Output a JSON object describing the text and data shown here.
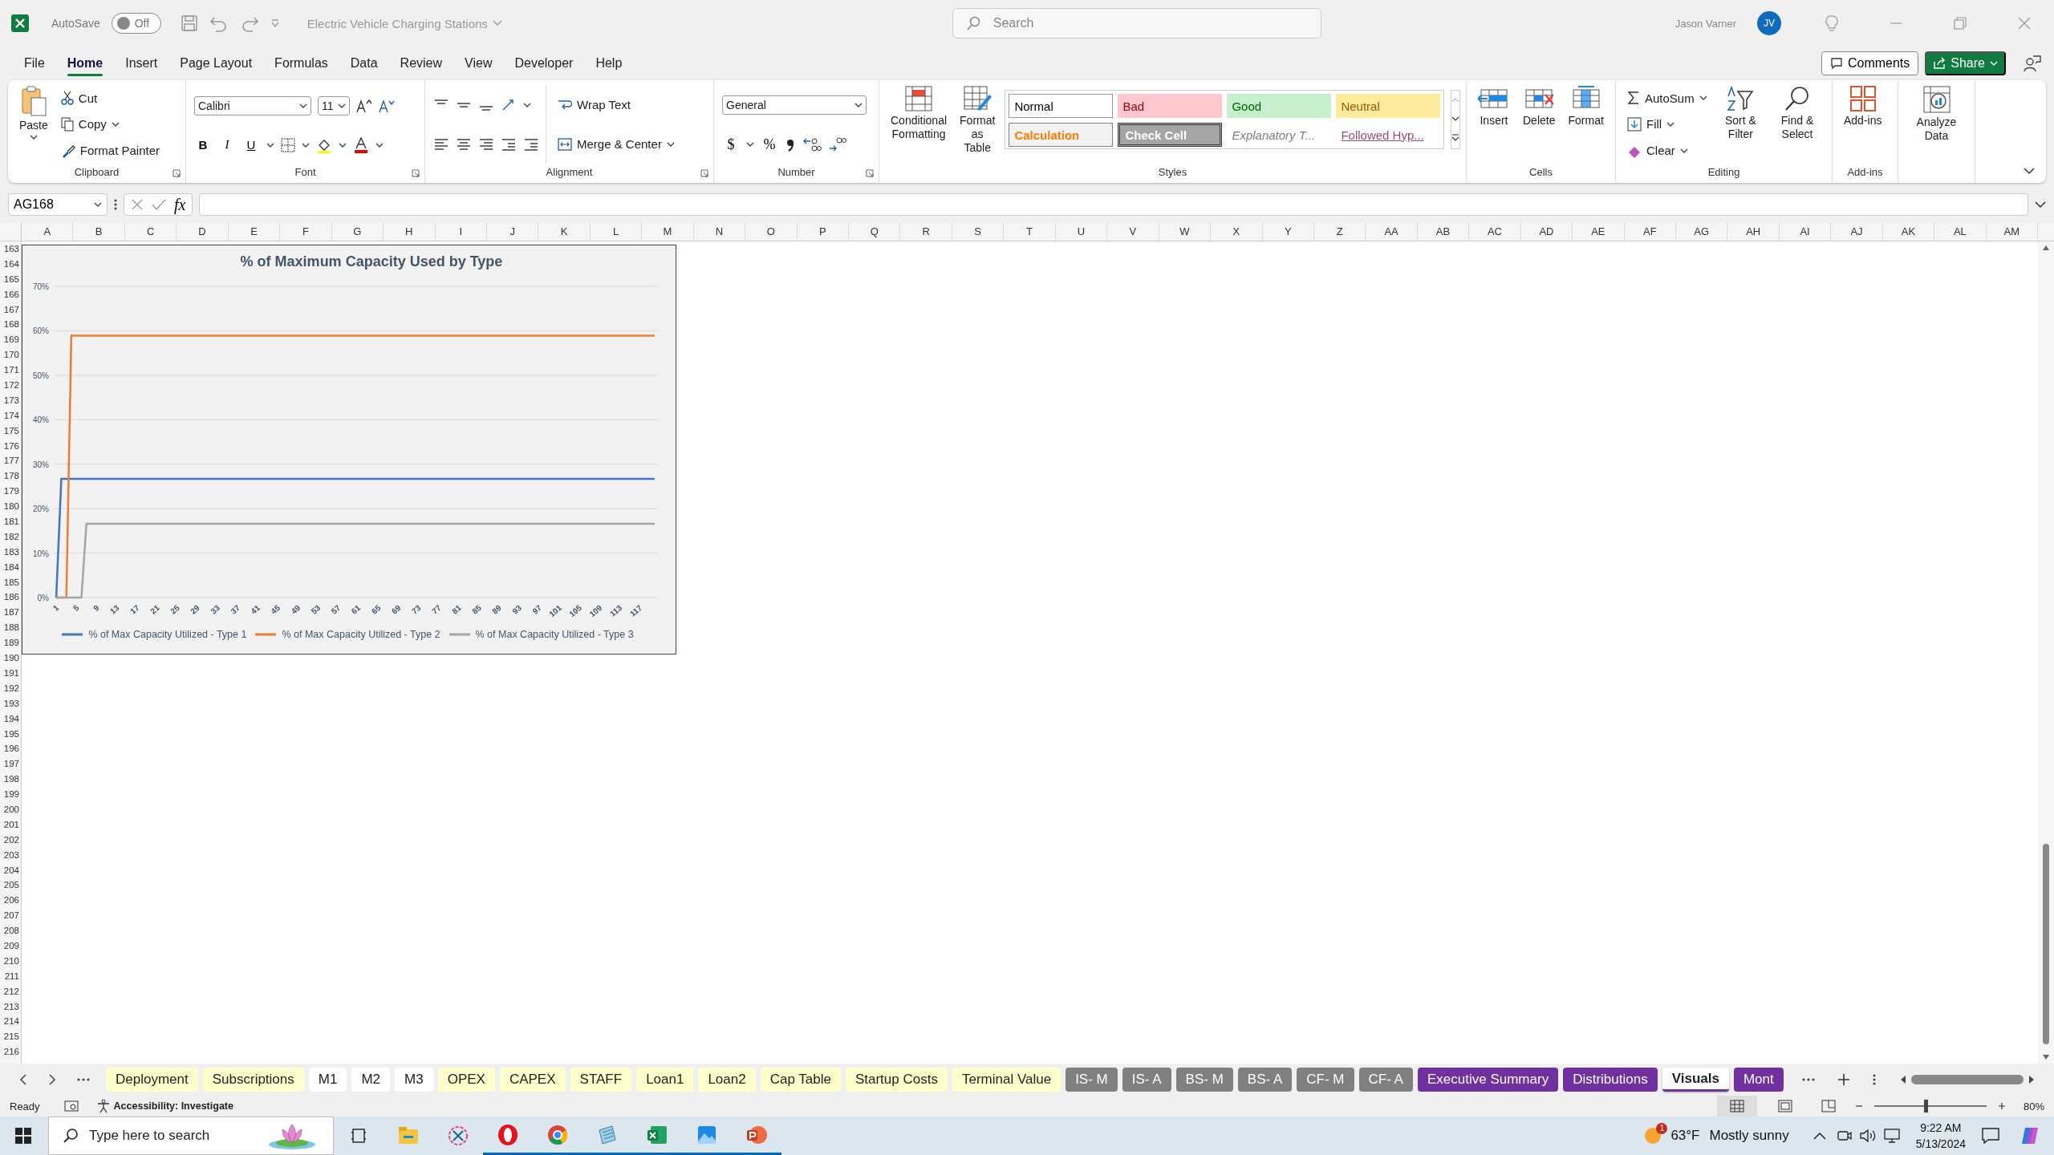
{
  "title_bar": {
    "autosave_label": "AutoSave",
    "autosave": {
      "on": false,
      "state_text": "Off"
    },
    "document_title": "Electric Vehicle Charging Stations",
    "search": {
      "placeholder": "Search"
    },
    "user_name": "Jason Varner",
    "avatar_initials": "JV"
  },
  "menu_tabs": [
    {
      "label": "File",
      "selected": false
    },
    {
      "label": "Home",
      "selected": true
    },
    {
      "label": "Insert",
      "selected": false
    },
    {
      "label": "Page Layout",
      "selected": false
    },
    {
      "label": "Formulas",
      "selected": false
    },
    {
      "label": "Data",
      "selected": false
    },
    {
      "label": "Review",
      "selected": false
    },
    {
      "label": "View",
      "selected": false
    },
    {
      "label": "Developer",
      "selected": false
    },
    {
      "label": "Help",
      "selected": false
    }
  ],
  "menu_actions": {
    "comments": "Comments",
    "share": "Share"
  },
  "ribbon": {
    "clipboard": {
      "label": "Clipboard",
      "paste": "Paste",
      "cut": "Cut",
      "copy": "Copy",
      "format_painter": "Format Painter"
    },
    "font": {
      "label": "Font",
      "name": "Calibri",
      "size": "11",
      "bold": "B",
      "italic": "I",
      "underline": "U"
    },
    "alignment": {
      "label": "Alignment",
      "wrap_text": "Wrap Text",
      "merge_center": "Merge & Center"
    },
    "number": {
      "label": "Number",
      "format": "General",
      "currency": "$",
      "percent": "%"
    },
    "styles": {
      "label": "Styles",
      "conditional_formatting": "Conditional Formatting",
      "format_as_table": "Format as Table",
      "gallery": [
        {
          "label": "Normal",
          "kind": "normal"
        },
        {
          "label": "Bad",
          "kind": "bad"
        },
        {
          "label": "Good",
          "kind": "good"
        },
        {
          "label": "Neutral",
          "kind": "neutral"
        },
        {
          "label": "Calculation",
          "kind": "calculation"
        },
        {
          "label": "Check Cell",
          "kind": "check"
        },
        {
          "label": "Explanatory T...",
          "kind": "explanatory"
        },
        {
          "label": "Followed Hyp...",
          "kind": "followed"
        }
      ]
    },
    "cells": {
      "label": "Cells",
      "insert": "Insert",
      "delete": "Delete",
      "format": "Format"
    },
    "editing": {
      "label": "Editing",
      "autosum": "AutoSum",
      "fill": "Fill",
      "clear": "Clear",
      "sort_filter": "Sort & Filter",
      "find_select": "Find & Select"
    },
    "addins": {
      "label": "Add-ins",
      "button": "Add-ins"
    },
    "analyze": {
      "button": "Analyze Data"
    }
  },
  "formula_bar": {
    "name_box": "AG168",
    "fx": "fx"
  },
  "sheet": {
    "columns": [
      "A",
      "B",
      "C",
      "D",
      "E",
      "F",
      "G",
      "H",
      "I",
      "J",
      "K",
      "L",
      "M",
      "N",
      "O",
      "P",
      "Q",
      "R",
      "S",
      "T",
      "U",
      "V",
      "W",
      "X",
      "Y",
      "Z",
      "AA",
      "AB",
      "AC",
      "AD",
      "AE",
      "AF",
      "AG",
      "AH",
      "AI",
      "AJ",
      "AK",
      "AL",
      "AM"
    ],
    "rows": [
      "163",
      "164",
      "165",
      "166",
      "167",
      "168",
      "169",
      "170",
      "171",
      "172",
      "173",
      "174",
      "175",
      "176",
      "177",
      "178",
      "179",
      "180",
      "181",
      "182",
      "183",
      "184",
      "185",
      "186",
      "187",
      "188",
      "189",
      "190",
      "191",
      "192",
      "193",
      "194",
      "195",
      "196",
      "197",
      "198",
      "199",
      "200",
      "201",
      "202",
      "203",
      "204",
      "205",
      "206",
      "207",
      "208",
      "209",
      "210",
      "211",
      "212",
      "213",
      "214",
      "215",
      "216"
    ],
    "chart_data": {
      "type": "line",
      "title": "% of Maximum Capacity Used by Type",
      "x": [
        1,
        2,
        3,
        4,
        5,
        6,
        7,
        8,
        9,
        10,
        11,
        12,
        13,
        14,
        15,
        16,
        17,
        18,
        19,
        20,
        21,
        22,
        23,
        24,
        25,
        26,
        27,
        28,
        29,
        30,
        31,
        32,
        33,
        34,
        35,
        36,
        37,
        38,
        39,
        40,
        41,
        42,
        43,
        44,
        45,
        46,
        47,
        48,
        49,
        50,
        51,
        52,
        53,
        54,
        55,
        56,
        57,
        58,
        59,
        60,
        61,
        62,
        63,
        64,
        65,
        66,
        67,
        68,
        69,
        70,
        71,
        72,
        73,
        74,
        75,
        76,
        77,
        78,
        79,
        80,
        81,
        82,
        83,
        84,
        85,
        86,
        87,
        88,
        89,
        90,
        91,
        92,
        93,
        94,
        95,
        96,
        97,
        98,
        99,
        100,
        101,
        102,
        103,
        104,
        105,
        106,
        107,
        108,
        109,
        110,
        111,
        112,
        113,
        114,
        115,
        116,
        117,
        118,
        119,
        120
      ],
      "xticks": [
        1,
        5,
        9,
        13,
        17,
        21,
        25,
        29,
        33,
        37,
        41,
        45,
        49,
        53,
        57,
        61,
        65,
        69,
        73,
        77,
        81,
        85,
        89,
        93,
        97,
        101,
        105,
        109,
        113,
        117
      ],
      "xlim": [
        0.5,
        120.5
      ],
      "ylim": [
        0,
        0.7
      ],
      "grid": true,
      "yticks": [
        {
          "value": 0,
          "label": "0%"
        },
        {
          "value": 0.1,
          "label": "10%"
        },
        {
          "value": 0.2,
          "label": "20%"
        },
        {
          "value": 0.3,
          "label": "30%"
        },
        {
          "value": 0.4,
          "label": "40%"
        },
        {
          "value": 0.5,
          "label": "50%"
        },
        {
          "value": 0.6,
          "label": "60%"
        },
        {
          "value": 0.7,
          "label": "70%"
        }
      ],
      "series": [
        {
          "name": "% of Max Capacity Utilized - Type 1",
          "color": "#4472c4",
          "values": [
            0,
            0.267,
            0.267,
            0.267,
            0.267,
            0.267,
            0.267,
            0.267,
            0.267,
            0.267,
            0.267,
            0.267,
            0.267,
            0.267,
            0.267,
            0.267,
            0.267,
            0.267,
            0.267,
            0.267,
            0.267,
            0.267,
            0.267,
            0.267,
            0.267,
            0.267,
            0.267,
            0.267,
            0.267,
            0.267,
            0.267,
            0.267,
            0.267,
            0.267,
            0.267,
            0.267,
            0.267,
            0.267,
            0.267,
            0.267,
            0.267,
            0.267,
            0.267,
            0.267,
            0.267,
            0.267,
            0.267,
            0.267,
            0.267,
            0.267,
            0.267,
            0.267,
            0.267,
            0.267,
            0.267,
            0.267,
            0.267,
            0.267,
            0.267,
            0.267,
            0.267,
            0.267,
            0.267,
            0.267,
            0.267,
            0.267,
            0.267,
            0.267,
            0.267,
            0.267,
            0.267,
            0.267,
            0.267,
            0.267,
            0.267,
            0.267,
            0.267,
            0.267,
            0.267,
            0.267,
            0.267,
            0.267,
            0.267,
            0.267,
            0.267,
            0.267,
            0.267,
            0.267,
            0.267,
            0.267,
            0.267,
            0.267,
            0.267,
            0.267,
            0.267,
            0.267,
            0.267,
            0.267,
            0.267,
            0.267,
            0.267,
            0.267,
            0.267,
            0.267,
            0.267,
            0.267,
            0.267,
            0.267,
            0.267,
            0.267,
            0.267,
            0.267,
            0.267,
            0.267,
            0.267,
            0.267,
            0.267,
            0.267,
            0.267,
            0.267
          ]
        },
        {
          "name": "% of Max Capacity Utilized - Type 2",
          "color": "#ed7d31",
          "values": [
            0,
            0,
            0,
            0.589,
            0.589,
            0.589,
            0.589,
            0.589,
            0.589,
            0.589,
            0.589,
            0.589,
            0.589,
            0.589,
            0.589,
            0.589,
            0.589,
            0.589,
            0.589,
            0.589,
            0.589,
            0.589,
            0.589,
            0.589,
            0.589,
            0.589,
            0.589,
            0.589,
            0.589,
            0.589,
            0.589,
            0.589,
            0.589,
            0.589,
            0.589,
            0.589,
            0.589,
            0.589,
            0.589,
            0.589,
            0.589,
            0.589,
            0.589,
            0.589,
            0.589,
            0.589,
            0.589,
            0.589,
            0.589,
            0.589,
            0.589,
            0.589,
            0.589,
            0.589,
            0.589,
            0.589,
            0.589,
            0.589,
            0.589,
            0.589,
            0.589,
            0.589,
            0.589,
            0.589,
            0.589,
            0.589,
            0.589,
            0.589,
            0.589,
            0.589,
            0.589,
            0.589,
            0.589,
            0.589,
            0.589,
            0.589,
            0.589,
            0.589,
            0.589,
            0.589,
            0.589,
            0.589,
            0.589,
            0.589,
            0.589,
            0.589,
            0.589,
            0.589,
            0.589,
            0.589,
            0.589,
            0.589,
            0.589,
            0.589,
            0.589,
            0.589,
            0.589,
            0.589,
            0.589,
            0.589,
            0.589,
            0.589,
            0.589,
            0.589,
            0.589,
            0.589,
            0.589,
            0.589,
            0.589,
            0.589,
            0.589,
            0.589,
            0.589,
            0.589,
            0.589,
            0.589,
            0.589,
            0.589,
            0.589,
            0.589
          ]
        },
        {
          "name": "% of Max Capacity Utilized - Type 3",
          "color": "#a5a5a5",
          "values": [
            0,
            0,
            0,
            0,
            0,
            0,
            0.166,
            0.166,
            0.166,
            0.166,
            0.166,
            0.166,
            0.166,
            0.166,
            0.166,
            0.166,
            0.166,
            0.166,
            0.166,
            0.166,
            0.166,
            0.166,
            0.166,
            0.166,
            0.166,
            0.166,
            0.166,
            0.166,
            0.166,
            0.166,
            0.166,
            0.166,
            0.166,
            0.166,
            0.166,
            0.166,
            0.166,
            0.166,
            0.166,
            0.166,
            0.166,
            0.166,
            0.166,
            0.166,
            0.166,
            0.166,
            0.166,
            0.166,
            0.166,
            0.166,
            0.166,
            0.166,
            0.166,
            0.166,
            0.166,
            0.166,
            0.166,
            0.166,
            0.166,
            0.166,
            0.166,
            0.166,
            0.166,
            0.166,
            0.166,
            0.166,
            0.166,
            0.166,
            0.166,
            0.166,
            0.166,
            0.166,
            0.166,
            0.166,
            0.166,
            0.166,
            0.166,
            0.166,
            0.166,
            0.166,
            0.166,
            0.166,
            0.166,
            0.166,
            0.166,
            0.166,
            0.166,
            0.166,
            0.166,
            0.166,
            0.166,
            0.166,
            0.166,
            0.166,
            0.166,
            0.166,
            0.166,
            0.166,
            0.166,
            0.166,
            0.166,
            0.166,
            0.166,
            0.166,
            0.166,
            0.166,
            0.166,
            0.166,
            0.166,
            0.166,
            0.166,
            0.166,
            0.166,
            0.166,
            0.166,
            0.166,
            0.166,
            0.166,
            0.166,
            0.166
          ]
        }
      ]
    }
  },
  "sheet_tabs": [
    {
      "label": "Deployment",
      "color": "#ffffcc",
      "selected": false
    },
    {
      "label": "Subscriptions",
      "color": "#ffffcc",
      "selected": false
    },
    {
      "label": "M1",
      "color": "#ffffff",
      "selected": false
    },
    {
      "label": "M2",
      "color": "#ffffff",
      "selected": false
    },
    {
      "label": "M3",
      "color": "#ffffff",
      "selected": false
    },
    {
      "label": "OPEX",
      "color": "#ffffcc",
      "selected": false
    },
    {
      "label": "CAPEX",
      "color": "#ffffcc",
      "selected": false
    },
    {
      "label": "STAFF",
      "color": "#ffffcc",
      "selected": false
    },
    {
      "label": "Loan1",
      "color": "#ffffcc",
      "selected": false
    },
    {
      "label": "Loan2",
      "color": "#ffffcc",
      "selected": false
    },
    {
      "label": "Cap Table",
      "color": "#ffffcc",
      "selected": false
    },
    {
      "label": "Startup Costs",
      "color": "#ffffcc",
      "selected": false
    },
    {
      "label": "Terminal Value",
      "color": "#ffffcc",
      "selected": false
    },
    {
      "label": "IS- M",
      "color": "#808080",
      "selected": false
    },
    {
      "label": "IS- A",
      "color": "#808080",
      "selected": false
    },
    {
      "label": "BS- M",
      "color": "#808080",
      "selected": false
    },
    {
      "label": "BS- A",
      "color": "#808080",
      "selected": false
    },
    {
      "label": "CF- M",
      "color": "#808080",
      "selected": false
    },
    {
      "label": "CF- A",
      "color": "#808080",
      "selected": false
    },
    {
      "label": "Executive Summary",
      "color": "#7030a0",
      "selected": false
    },
    {
      "label": "Distributions",
      "color": "#7030a0",
      "selected": false
    },
    {
      "label": "Visuals",
      "color": "#7030a0",
      "selected": true
    },
    {
      "label": "Mont",
      "color": "#7030a0",
      "selected": false
    }
  ],
  "status_bar": {
    "ready": "Ready",
    "accessibility": "Accessibility: Investigate",
    "zoom": {
      "level": 0.46,
      "reading": "80%"
    }
  },
  "taskbar": {
    "search": {
      "placeholder": "Type here to search"
    },
    "apps": [
      {
        "kind": "explorer",
        "running": false
      },
      {
        "kind": "snip",
        "running": false
      },
      {
        "kind": "opera",
        "running": true
      },
      {
        "kind": "chrome",
        "running": true
      },
      {
        "kind": "notepad",
        "running": true
      },
      {
        "kind": "excel",
        "running": true
      },
      {
        "kind": "photos",
        "running": true
      },
      {
        "kind": "powerpoint",
        "running": true
      }
    ],
    "weather": {
      "badge": "1",
      "temperature": "63°F",
      "condition": "Mostly sunny"
    },
    "time": "9:22 AM",
    "date": "5/13/2024"
  }
}
